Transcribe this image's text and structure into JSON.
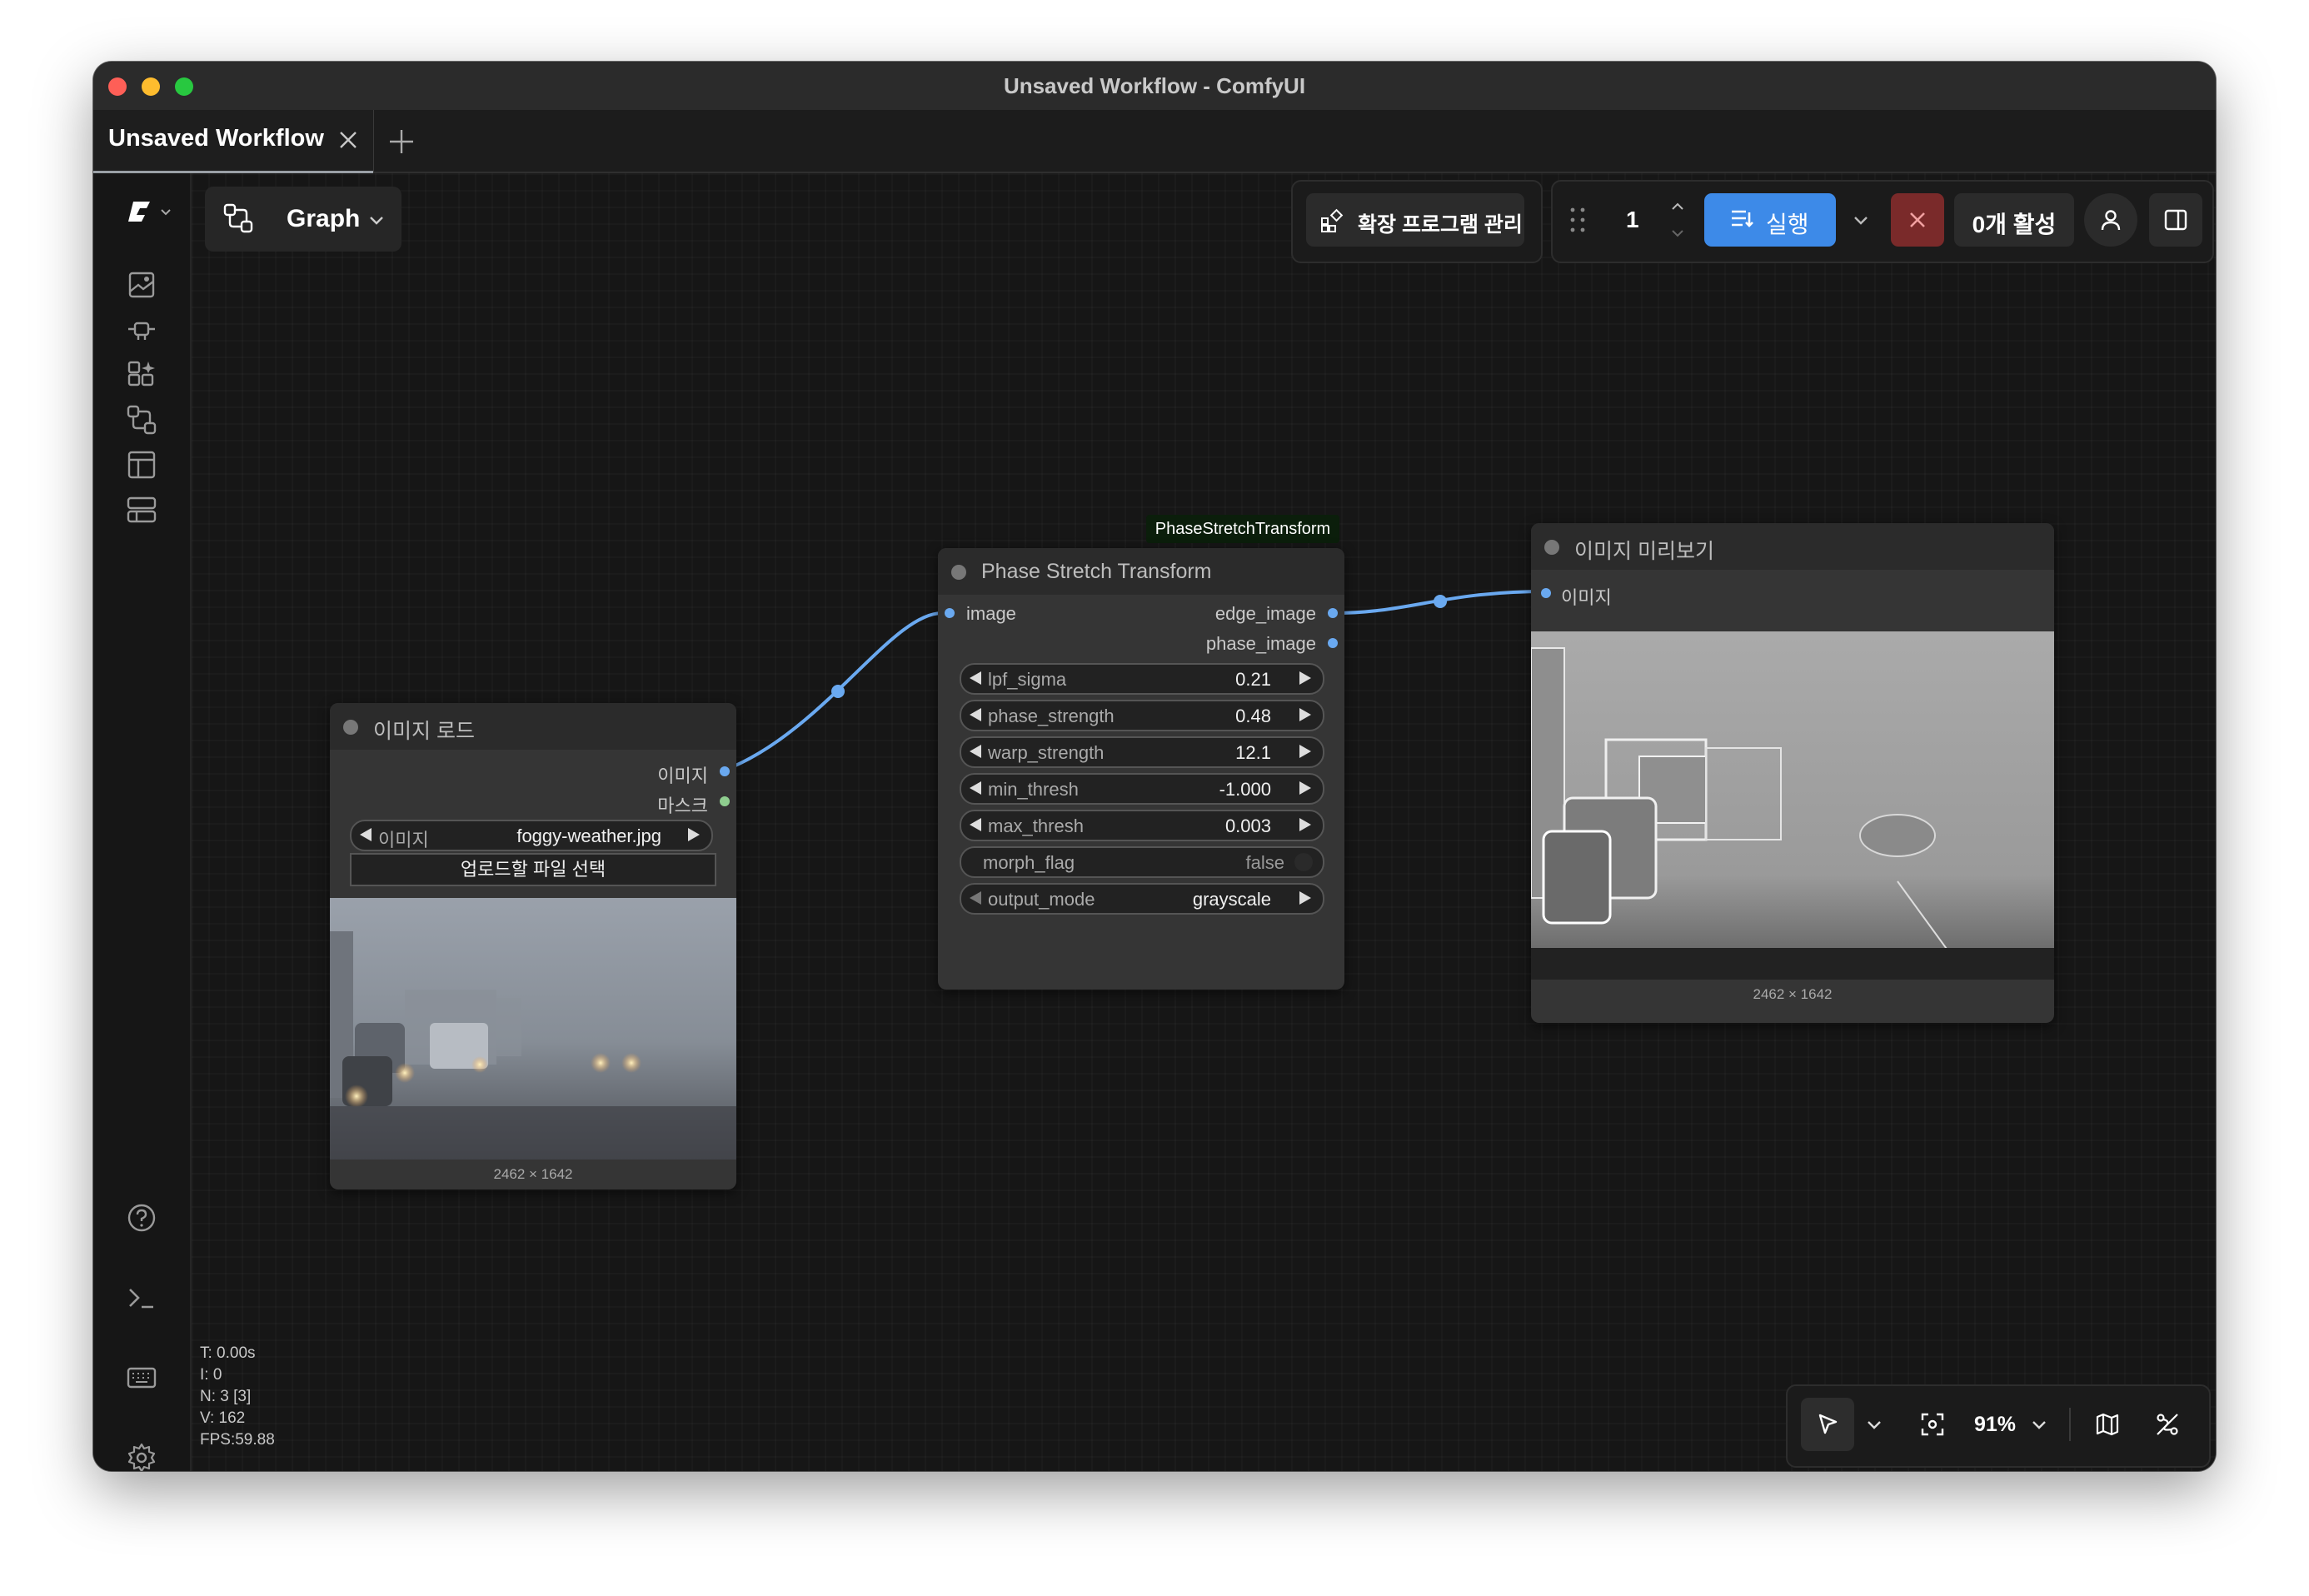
{
  "window": {
    "title": "Unsaved Workflow - ComfyUI"
  },
  "tabs": [
    {
      "label": "Unsaved Workflow",
      "close_icon": "close-icon"
    }
  ],
  "new_tab_icon": "plus-icon",
  "sidebar": {
    "logo_icon": "comfy-logo-icon",
    "items": [
      {
        "name": "media-assets",
        "icon": "image-sparkle-icon"
      },
      {
        "name": "model-library",
        "icon": "plug-icon"
      },
      {
        "name": "node-library",
        "icon": "grid-sparkle-icon"
      },
      {
        "name": "workflows",
        "icon": "workflow-icon"
      },
      {
        "name": "templates",
        "icon": "layout-icon"
      },
      {
        "name": "queue",
        "icon": "layers-icon"
      }
    ],
    "bottom_items": [
      {
        "name": "help",
        "icon": "help-icon"
      },
      {
        "name": "terminal",
        "icon": "terminal-icon"
      },
      {
        "name": "keybindings",
        "icon": "keyboard-icon"
      },
      {
        "name": "settings",
        "icon": "gear-icon"
      }
    ]
  },
  "toolbar": {
    "graph_label": "Graph",
    "extensions_label": "확장 프로그램 관리",
    "queue_count": "1",
    "run_label": "실행",
    "active_label": "0개 활성"
  },
  "nodes": {
    "load_image": {
      "title": "이미지 로드",
      "outputs": [
        "이미지",
        "마스크"
      ],
      "image_widget": {
        "label": "이미지",
        "value": "foggy-weather.jpg"
      },
      "upload_label": "업로드할 파일 선택",
      "image_caption": "2462 × 1642"
    },
    "pst": {
      "tag": "PhaseStretchTransform",
      "title": "Phase Stretch Transform",
      "input": "image",
      "outputs": [
        "edge_image",
        "phase_image"
      ],
      "widgets": [
        {
          "label": "lpf_sigma",
          "value": "0.21"
        },
        {
          "label": "phase_strength",
          "value": "0.48"
        },
        {
          "label": "warp_strength",
          "value": "12.1"
        },
        {
          "label": "min_thresh",
          "value": "-1.000"
        },
        {
          "label": "max_thresh",
          "value": "0.003"
        },
        {
          "label": "morph_flag",
          "value": "false"
        },
        {
          "label": "output_mode",
          "value": "grayscale"
        }
      ]
    },
    "preview": {
      "title": "이미지 미리보기",
      "input": "이미지",
      "image_caption": "2462 × 1642"
    }
  },
  "stats": {
    "t": "T: 0.00s",
    "i": "I: 0",
    "n": "N: 3 [3]",
    "v": "V: 162",
    "fps": "FPS:59.88"
  },
  "zoom": {
    "level": "91%"
  },
  "colors": {
    "accent": "#3d8ae8",
    "link": "#6aa9f0",
    "cancel": "#7a2a2a",
    "canvas": "#161616",
    "node_body": "#353535"
  }
}
